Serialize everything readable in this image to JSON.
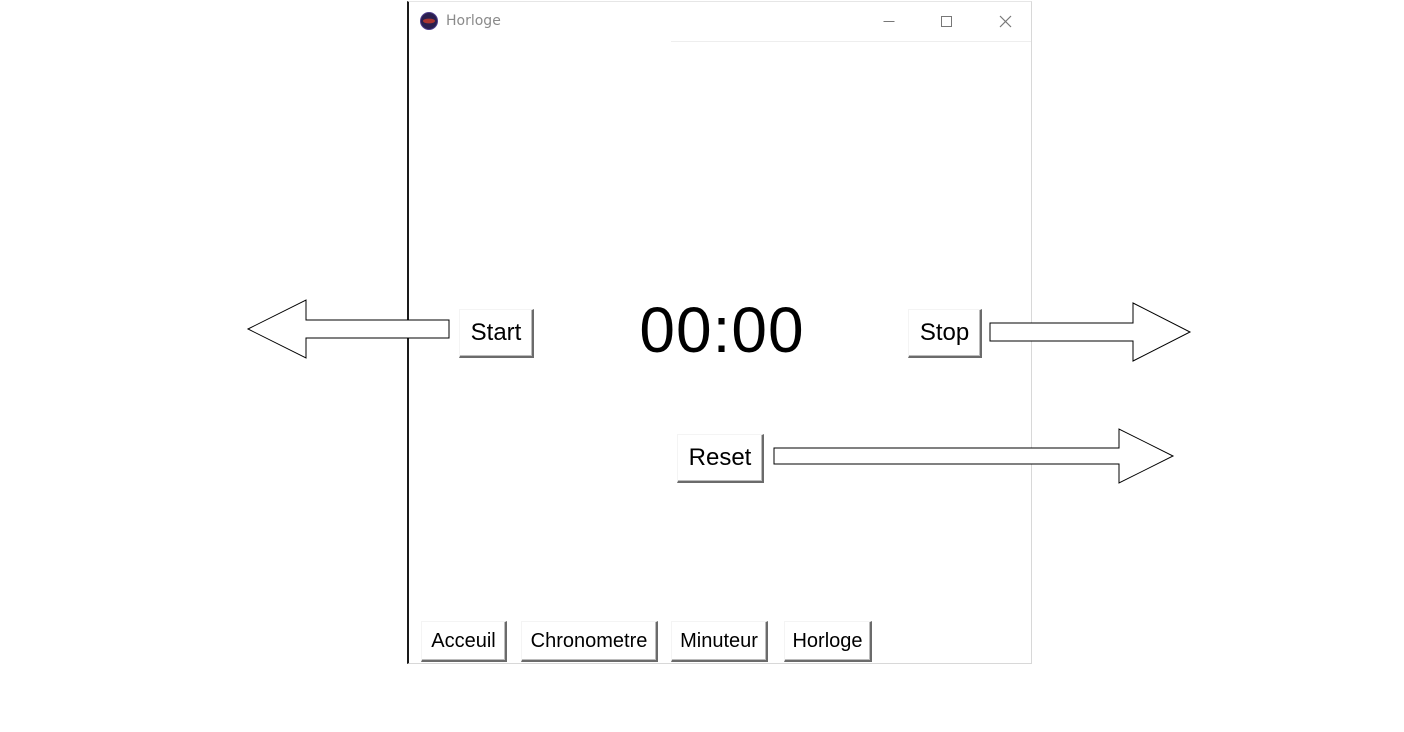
{
  "window": {
    "title": "Horloge",
    "controls": {
      "minimize": "minimize-icon",
      "maximize": "maximize-icon",
      "close": "close-icon"
    }
  },
  "stopwatch": {
    "time": "00:00",
    "start_label": "Start",
    "stop_label": "Stop",
    "reset_label": "Reset"
  },
  "nav": {
    "items": [
      {
        "label": "Acceuil"
      },
      {
        "label": "Chronometre"
      },
      {
        "label": "Minuteur"
      },
      {
        "label": "Horloge"
      }
    ]
  },
  "annotations": {
    "arrow_left": "arrow-left-icon",
    "arrow_right": "arrow-right-icon",
    "stroke_color": "#000000",
    "fill_color": "#ffffff"
  },
  "colors": {
    "background": "#ffffff",
    "title_text": "#8a8a8a",
    "app_icon_outer": "#2a1f4f",
    "app_icon_inner": "#c0392b"
  }
}
